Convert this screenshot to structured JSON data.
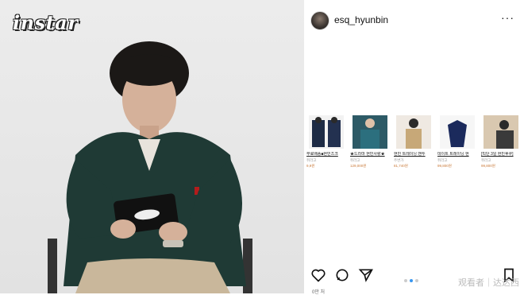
{
  "video": {
    "logo": "instar"
  },
  "post": {
    "username": "esq_hyunbin",
    "more_label": "···",
    "likes_text": "0만 처"
  },
  "products": [
    {
      "title": "무료배송■현빈츠크",
      "seller": "쥐라고",
      "price": "9,9원"
    },
    {
      "title": "★드라마 현빈사랑★",
      "seller": "쥐라고",
      "price": "129,000원"
    },
    {
      "title": "현빈 트레이닝 맨투",
      "seller": "주변가",
      "price": "81,740원"
    },
    {
      "title": "데이트 트레이닝 현",
      "seller": "쥐라고",
      "price": "99,800원"
    },
    {
      "title": "[빅단 3일 현빈후쿠]",
      "seller": "쥐라고",
      "price": "99,800원"
    }
  ],
  "carousel": {
    "count": 3,
    "active_index": 1
  },
  "watermark": "观看者｜达达西"
}
